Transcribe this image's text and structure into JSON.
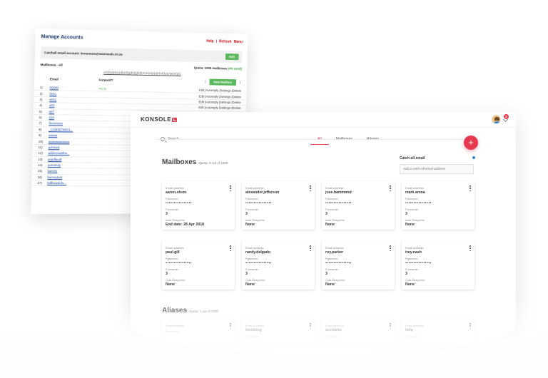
{
  "old": {
    "title": "Manage Accounts",
    "links": [
      "Help",
      "|",
      "Refresh",
      "Menu"
    ],
    "catchall_label": "Catchall email account: 0nnnnnnn@teamseals.co.za",
    "catchall_edit": "Edit",
    "mailboxes_label": "Mailboxes - All",
    "quota_prefix": "Quota: 1000 mailboxes",
    "quota_pct": "(4% used)",
    "alpha": "All|0|a|b|c|d|e|f|g|h|i|j|k|l|m|n|o|p|q|r|s|t|u|v|w|x|y|z",
    "col_email": "Email",
    "col_forward": "Forward?",
    "new_mailbox": "New Mailbox",
    "row_actions": "Edit |Autoreply |Settings |Delete",
    "rows": [
      {
        "n": "1)",
        "email": "00000",
        "fwd": "Yes (3)"
      },
      {
        "n": "2)",
        "email": "0001",
        "fwd": ""
      },
      {
        "n": "3)",
        "email": "0002",
        "fwd": ""
      },
      {
        "n": "4)",
        "email": "003",
        "fwd": ""
      },
      {
        "n": "5)",
        "email": "007",
        "fwd": ""
      },
      {
        "n": "6)",
        "email": "010",
        "fwd": ""
      },
      {
        "n": "7)",
        "email": "0nnnnnnn",
        "fwd": ""
      },
      {
        "n": "8)",
        "email": "_123456789O1...",
        "fwd": ""
      },
      {
        "n": "9)",
        "email": "aaaaa",
        "fwd": ""
      },
      {
        "n": "10)",
        "email": "aaaaaaaaaaaa",
        "fwd": ""
      },
      {
        "n": "11)",
        "email": "achmed",
        "fwd": ""
      },
      {
        "n": "12)",
        "email": "addressabfrw...",
        "fwd": ""
      },
      {
        "n": "13)",
        "email": "asadfasdf",
        "fwd": ""
      },
      {
        "n": "14)",
        "email": "autoandy",
        "fwd": ""
      },
      {
        "n": "15)",
        "email": "barney",
        "fwd": ""
      },
      {
        "n": "16)",
        "email": "barneytest",
        "fwd": ""
      },
      {
        "n": "17)",
        "email": "bdfforwardx...",
        "fwd": ""
      }
    ]
  },
  "new": {
    "logo": "KONSOLE",
    "badge": "2",
    "search_placeholder": "Search...",
    "tabs": [
      "All",
      "Mailboxes",
      "Aliases"
    ],
    "fab": "+",
    "mailboxes_title": "Mailboxes",
    "mailboxes_quota": "Quota: 8 out of 1000",
    "catchall_label": "Catch-all email",
    "catchall_placeholder": "Add a catch-all email address",
    "aliases_title": "Aliases",
    "aliases_quota": "Quota: 1 out of 1000",
    "lbl_email": "Email address",
    "lbl_password": "Password",
    "lbl_forwarder": "Forwarder",
    "lbl_autoresp": "Auto Response",
    "mailboxes": [
      {
        "email": "aaron.olson",
        "password": "••••••••••••••••",
        "forwarder": "3",
        "auto": "End date: 28 Apr 2018"
      },
      {
        "email": "alexander.jefferson",
        "password": "••••••••••••••••",
        "forwarder": "3",
        "auto": "None"
      },
      {
        "email": "jose.hammond",
        "password": "••••••••••••••••",
        "forwarder": "3",
        "auto": "None"
      },
      {
        "email": "mark.arena",
        "password": "••••••••••••••••",
        "forwarder": "3",
        "auto": "None"
      },
      {
        "email": "paul.gill",
        "password": "••••••••••••••••",
        "forwarder": "3",
        "auto": "None"
      },
      {
        "email": "randy.delgado",
        "password": "••••••••••••••••",
        "forwarder": "3",
        "auto": "None"
      },
      {
        "email": "roy.parker",
        "password": "••••••••••••••••",
        "forwarder": "3",
        "auto": "None"
      },
      {
        "email": "troy.nash",
        "password": "••••••••••••••••",
        "forwarder": "3",
        "auto": "None"
      }
    ],
    "aliases": [
      {
        "email": ""
      },
      {
        "email": "invoicing"
      },
      {
        "email": "accounts"
      },
      {
        "email": "help"
      }
    ]
  }
}
